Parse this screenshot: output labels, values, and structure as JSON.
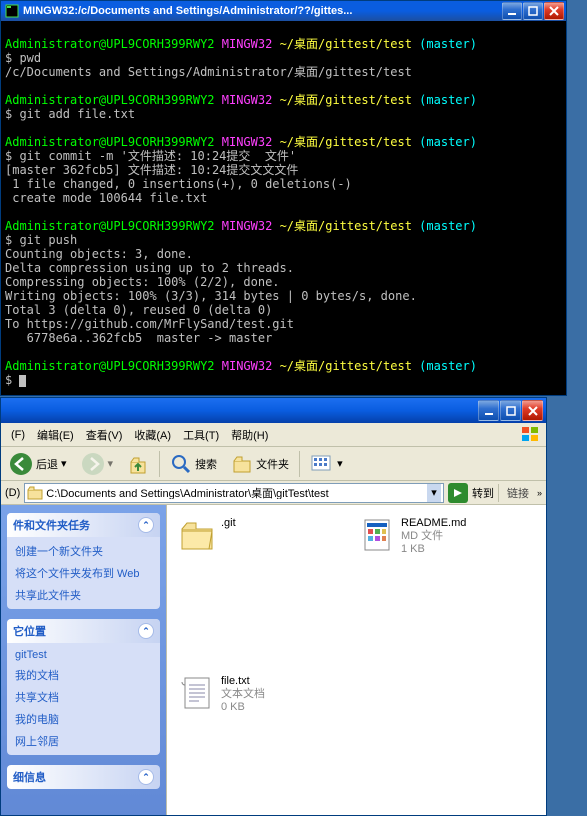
{
  "terminal": {
    "title": "MINGW32:/c/Documents and Settings/Administrator/??/gittes...",
    "prompt": {
      "user": "Administrator@UPL9CORH399RWY2",
      "shell": "MINGW32",
      "path": "~/桌面/gittest/test",
      "branch": "(master)"
    },
    "lines": {
      "cmd1": "$ pwd",
      "out1": "/c/Documents and Settings/Administrator/桌面/gittest/test",
      "cmd2": "$ git add file.txt",
      "cmd3": "$ git commit -m '文件描述: 10:24提交  文件'",
      "out3a": "[master 362fcb5] 文件描述: 10:24提交文文文件",
      "out3b": " 1 file changed, 0 insertions(+), 0 deletions(-)",
      "out3c": " create mode 100644 file.txt",
      "cmd4": "$ git push",
      "out4a": "Counting objects: 3, done.",
      "out4b": "Delta compression using up to 2 threads.",
      "out4c": "Compressing objects: 100% (2/2), done.",
      "out4d": "Writing objects: 100% (3/3), 314 bytes | 0 bytes/s, done.",
      "out4e": "Total 3 (delta 0), reused 0 (delta 0)",
      "out4f": "To https://github.com/MrFlySand/test.git",
      "out4g": "   6778e6a..362fcb5  master -> master",
      "cmd5": "$ "
    }
  },
  "explorer": {
    "menus": {
      "file": "(F)",
      "edit": "编辑(E)",
      "view": "查看(V)",
      "favorites": "收藏(A)",
      "tools": "工具(T)",
      "help": "帮助(H)"
    },
    "toolbar": {
      "back": "后退",
      "search": "搜索",
      "folders": "文件夹"
    },
    "address": {
      "label": "(D)",
      "value": "C:\\Documents and Settings\\Administrator\\桌面\\gitTest\\test",
      "go": "转到",
      "links": "链接"
    },
    "sidebar": {
      "panel1": {
        "title": "件和文件夹任务",
        "links": [
          "创建一个新文件夹",
          "将这个文件夹发布到 Web",
          "共享此文件夹"
        ]
      },
      "panel2": {
        "title": "它位置",
        "links": [
          "gitTest",
          "我的文档",
          "共享文档",
          "我的电脑",
          "网上邻居"
        ]
      },
      "panel3": {
        "title": "细信息"
      }
    },
    "files": [
      {
        "name": ".git",
        "type": "folder",
        "sub1": "",
        "sub2": ""
      },
      {
        "name": "README.md",
        "type": "md",
        "sub1": "MD 文件",
        "sub2": "1 KB"
      },
      {
        "name": "file.txt",
        "type": "txt",
        "sub1": "文本文档",
        "sub2": "0 KB"
      }
    ]
  }
}
